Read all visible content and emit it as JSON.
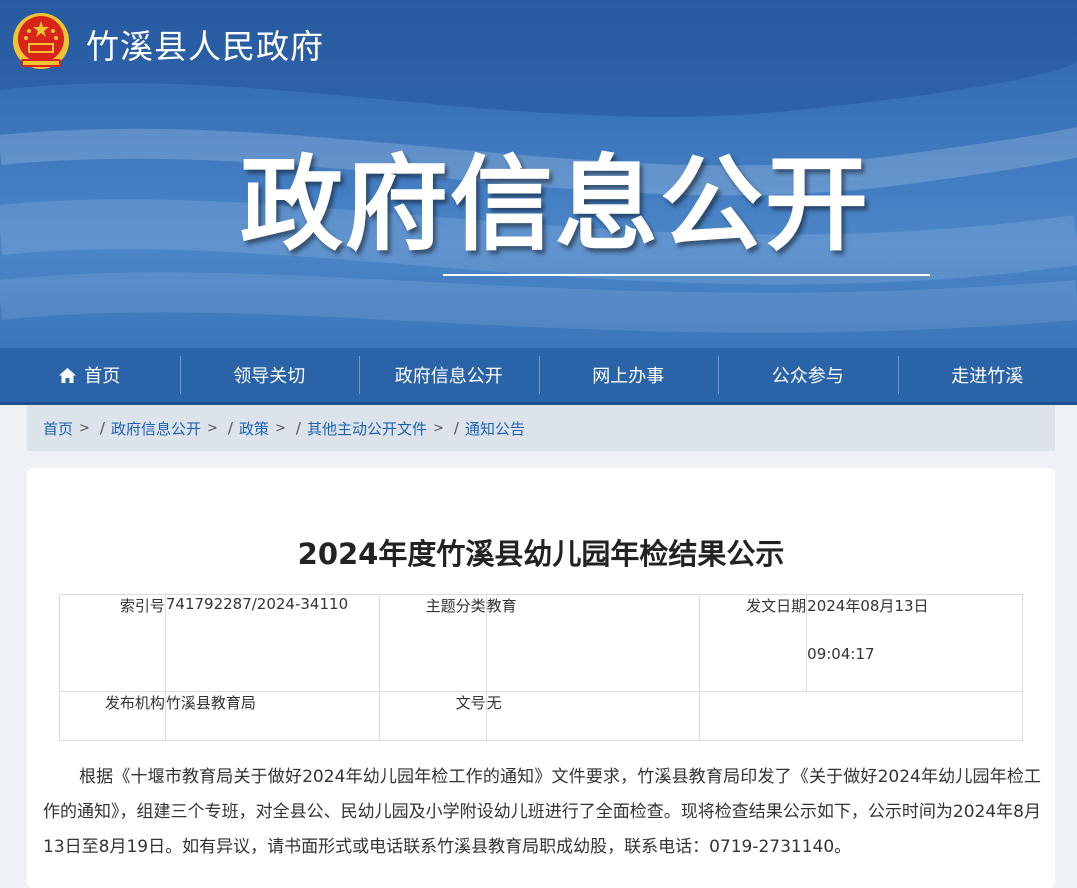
{
  "header": {
    "site_name": "竹溪县人民政府",
    "banner_title": "政府信息公开"
  },
  "nav": {
    "items": [
      {
        "label": "首页",
        "icon": "home-icon"
      },
      {
        "label": "领导关切"
      },
      {
        "label": "政府信息公开"
      },
      {
        "label": "网上办事"
      },
      {
        "label": "公众参与"
      },
      {
        "label": "走进竹溪"
      }
    ]
  },
  "breadcrumb": [
    "首页",
    "政府信息公开",
    "政策",
    "其他主动公开文件",
    "通知公告"
  ],
  "breadcrumb_sep": ">",
  "document": {
    "title": "2024年度竹溪县幼儿园年检结果公示",
    "meta": {
      "index_label": "索引号",
      "index_value": "741792287/2024-34110",
      "topic_label": "主题分类",
      "topic_value": "教育",
      "date_label": "发文日期",
      "date_value": "2024年08月13日",
      "time_value": "09:04:17",
      "publisher_label": "发布机构",
      "publisher_value": "竹溪县教育局",
      "docno_label": "文号",
      "docno_value": "无"
    },
    "body": "根据《十堰市教育局关于做好2024年幼儿园年检工作的通知》文件要求，竹溪县教育局印发了《关于做好2024年幼儿园年检工作的通知》，组建三个专班，对全县公、民幼儿园及小学附设幼儿班进行了全面检查。现将检查结果公示如下，公示时间为2024年8月13日至8月19日。如有异议，请书面形式或电话联系竹溪县教育局职成幼股，联系电话：0719-2731140。"
  },
  "colors": {
    "banner": "#3b74bb",
    "nav": "#2a63a8",
    "link": "#1d63b3",
    "emblem_red": "#d8251b",
    "emblem_gold": "#f4c430"
  }
}
